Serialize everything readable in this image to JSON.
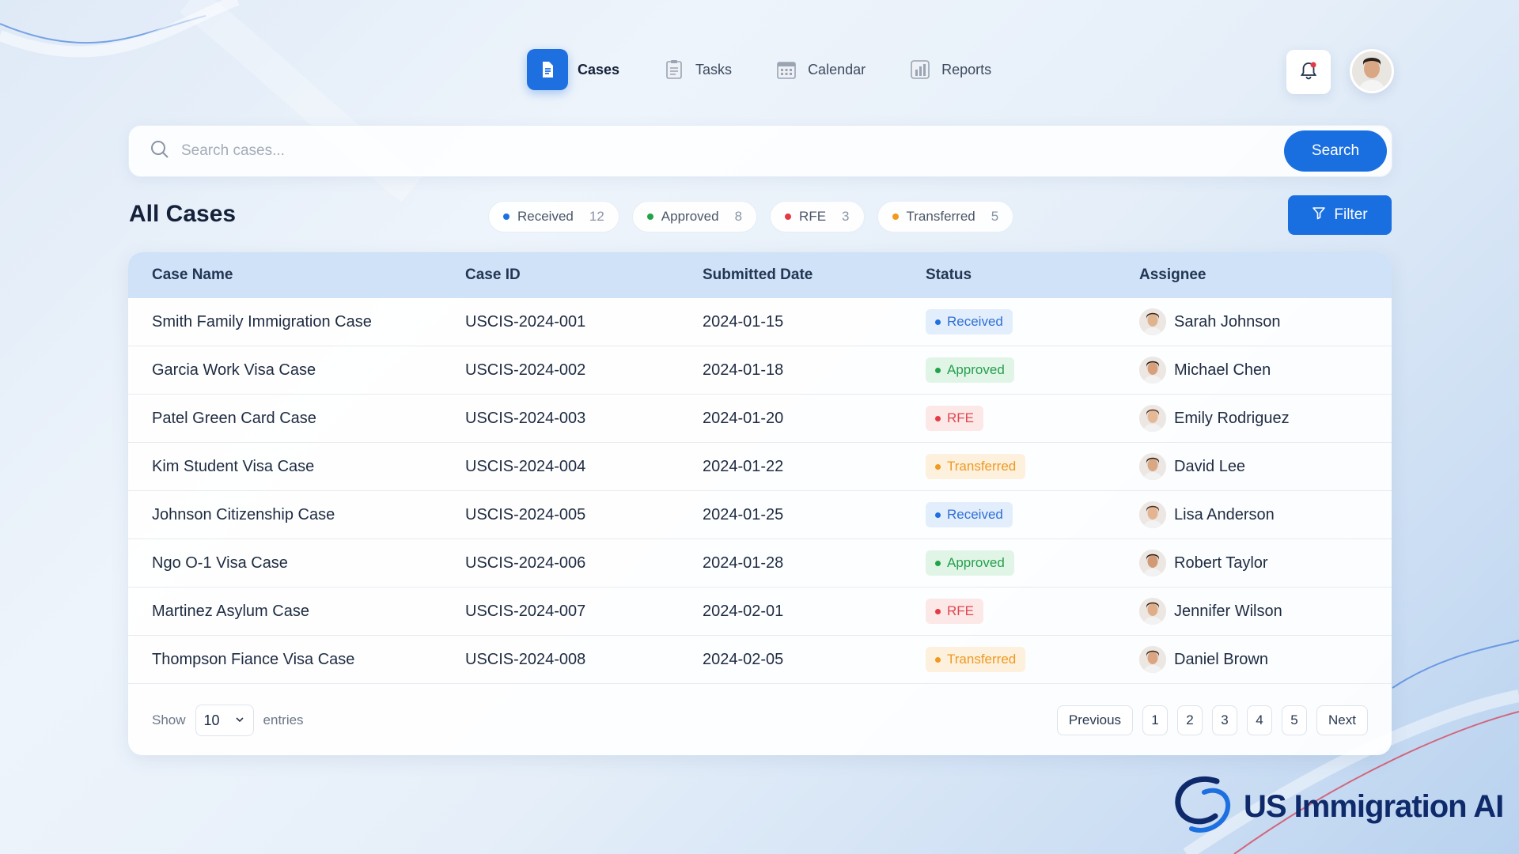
{
  "nav": {
    "items": [
      {
        "label": "Cases",
        "active": true,
        "icon": "document-icon"
      },
      {
        "label": "Tasks",
        "active": false,
        "icon": "clipboard-icon"
      },
      {
        "label": "Calendar",
        "active": false,
        "icon": "calendar-icon"
      },
      {
        "label": "Reports",
        "active": false,
        "icon": "bar-chart-icon"
      }
    ]
  },
  "search": {
    "placeholder": "Search cases...",
    "value": "",
    "button_label": "Search"
  },
  "page_title": "All Cases",
  "status_chips": [
    {
      "label": "Received",
      "count": "12",
      "color": "#1e6fe0"
    },
    {
      "label": "Approved",
      "count": "8",
      "color": "#22a348"
    },
    {
      "label": "RFE",
      "count": "3",
      "color": "#e33b45"
    },
    {
      "label": "Transferred",
      "count": "5",
      "color": "#f09a1e"
    }
  ],
  "filter_label": "Filter",
  "table": {
    "columns": [
      "Case Name",
      "Case ID",
      "Submitted Date",
      "Status",
      "Assignee"
    ],
    "rows": [
      {
        "name": "Smith Family Immigration Case",
        "id": "USCIS-2024-001",
        "date": "2024-01-15",
        "status": "Received",
        "assignee": "Sarah Johnson"
      },
      {
        "name": "Garcia Work Visa Case",
        "id": "USCIS-2024-002",
        "date": "2024-01-18",
        "status": "Approved",
        "assignee": "Michael Chen"
      },
      {
        "name": "Patel Green Card Case",
        "id": "USCIS-2024-003",
        "date": "2024-01-20",
        "status": "RFE",
        "assignee": "Emily Rodriguez"
      },
      {
        "name": "Kim Student Visa Case",
        "id": "USCIS-2024-004",
        "date": "2024-01-22",
        "status": "Transferred",
        "assignee": "David Lee"
      },
      {
        "name": "Johnson Citizenship Case",
        "id": "USCIS-2024-005",
        "date": "2024-01-25",
        "status": "Received",
        "assignee": "Lisa Anderson"
      },
      {
        "name": "Ngo O-1 Visa Case",
        "id": "USCIS-2024-006",
        "date": "2024-01-28",
        "status": "Approved",
        "assignee": "Robert Taylor"
      },
      {
        "name": "Martinez Asylum Case",
        "id": "USCIS-2024-007",
        "date": "2024-02-01",
        "status": "RFE",
        "assignee": "Jennifer Wilson"
      },
      {
        "name": "Thompson Fiance Visa Case",
        "id": "USCIS-2024-008",
        "date": "2024-02-05",
        "status": "Transferred",
        "assignee": "Daniel Brown"
      }
    ]
  },
  "footer": {
    "show_label": "Show",
    "entries_value": "10",
    "entries_label": "entries",
    "previous_label": "Previous",
    "pages": [
      "1",
      "2",
      "3",
      "4",
      "5"
    ],
    "next_label": "Next"
  },
  "brand": {
    "name": "US Immigration AI"
  },
  "colors": {
    "accent": "#1a6fe0",
    "header_bg": "#cfe2f7"
  }
}
